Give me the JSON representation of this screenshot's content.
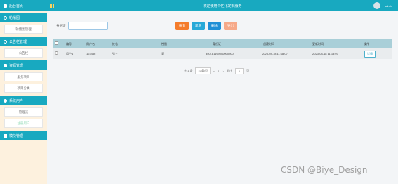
{
  "sidebar": {
    "title": "后台首页",
    "groups": [
      {
        "label": "轮播图",
        "items": [
          "轮播图管理"
        ]
      },
      {
        "label": "公告栏管理",
        "items": [
          "公告栏"
        ]
      },
      {
        "label": "资源管理",
        "items": [
          "服务项目",
          "项目分类"
        ]
      },
      {
        "label": "系统用户",
        "items": [
          "管理员",
          "注册用户"
        ]
      },
      {
        "label": "模块管理",
        "items": []
      }
    ]
  },
  "header": {
    "title": "欢迎使用个性化定制服务",
    "user": "admin"
  },
  "search": {
    "label": "身份证",
    "placeholder": ""
  },
  "toolbar": {
    "search": "搜索",
    "add": "新增",
    "delete": "删除",
    "export": "导出"
  },
  "table": {
    "columns": [
      "编号",
      "用户名",
      "姓名",
      "性别",
      "身份证",
      "创建时间",
      "更新时间",
      "操作"
    ],
    "rows": [
      {
        "id": "用户1",
        "username": "123456",
        "name": "张三",
        "gender": "男",
        "idcard": "350181199000000000",
        "created": "2023-04-18 11:18:07",
        "updated": "2023-04-18 11:18:07",
        "action": "详情"
      }
    ]
  },
  "pager": {
    "total": "共 1 条",
    "per_page": "10条/页",
    "prev": "<",
    "page": "1",
    "next": ">",
    "goto": "前往",
    "goto_page": "1",
    "page_unit": "页"
  },
  "watermark": "CSDN @Biye_Design",
  "colors": {
    "primary": "#18a9c0",
    "btn_search": "#f47c2c",
    "btn_add": "#27a9d8",
    "btn_delete": "#1f8fd6",
    "btn_export": "#f6a989"
  }
}
